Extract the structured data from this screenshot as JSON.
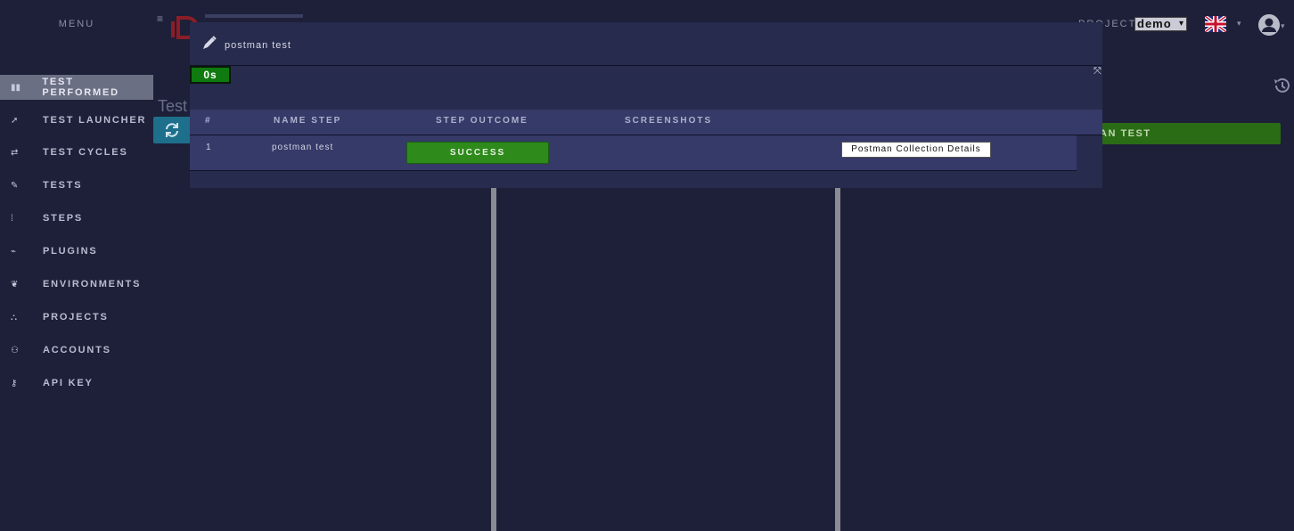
{
  "sidebar": {
    "title": "MENU",
    "items": [
      {
        "label": "TEST PERFORMED",
        "icon": "columns-icon",
        "glyph": "▮▮",
        "active": true
      },
      {
        "label": "TEST LAUNCHER",
        "icon": "rocket-icon",
        "glyph": "➚",
        "active": false
      },
      {
        "label": "TEST CYCLES",
        "icon": "cycle-icon",
        "glyph": "⇄",
        "active": false
      },
      {
        "label": "TESTS",
        "icon": "pencil-icon",
        "glyph": "✎",
        "active": false
      },
      {
        "label": "STEPS",
        "icon": "footsteps-icon",
        "glyph": "⁞",
        "active": false
      },
      {
        "label": "PLUGINS",
        "icon": "plug-icon",
        "glyph": "⌁",
        "active": false
      },
      {
        "label": "ENVIRONMENTS",
        "icon": "leaf-icon",
        "glyph": "❦",
        "active": false
      },
      {
        "label": "PROJECTS",
        "icon": "sitemap-icon",
        "glyph": "⛬",
        "active": false
      },
      {
        "label": "ACCOUNTS",
        "icon": "users-icon",
        "glyph": "⚇",
        "active": false
      },
      {
        "label": "API KEY",
        "icon": "key-icon",
        "glyph": "⚷",
        "active": false
      }
    ]
  },
  "header": {
    "menu_toggle": "≡",
    "project_label": "PROJECT:",
    "project_value": "demo",
    "select_chevron": "▾",
    "flag": "uk-flag-icon",
    "lang_caret": "▾",
    "user_caret": "▾"
  },
  "background": {
    "heading": "Test",
    "run_button_label": "AN TEST"
  },
  "modal": {
    "title": "postman test",
    "timer": "0s",
    "expand_glyph": "⤧",
    "columns": [
      "#",
      "NAME STEP",
      "STEP OUTCOME",
      "SCREENSHOTS"
    ],
    "rows": [
      {
        "index": "1",
        "name": "postman test",
        "outcome": "SUCCESS",
        "details_label": "Postman Collection Details"
      }
    ]
  },
  "colors": {
    "background": "#1d2038",
    "modal": "#272b4d",
    "table": "#353a68",
    "success": "#2d8a1b",
    "timer": "#0f7a0f",
    "active_nav": "#6b6f83"
  }
}
